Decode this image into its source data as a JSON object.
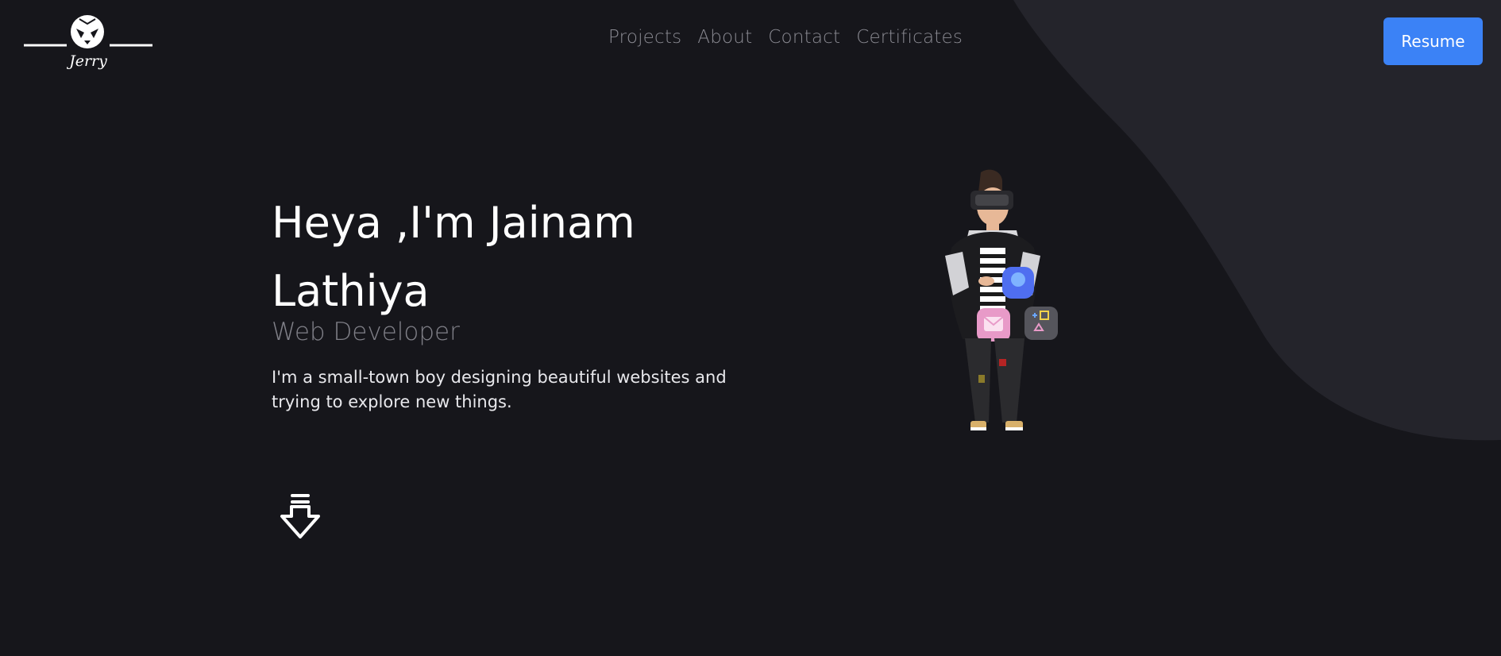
{
  "header": {
    "logo_text": "Jerry",
    "nav": [
      {
        "label": "Projects"
      },
      {
        "label": "About"
      },
      {
        "label": "Contact"
      },
      {
        "label": "Certificates"
      }
    ],
    "resume_label": "Resume"
  },
  "hero": {
    "title": "Heya ,I'm Jainam Lathiya",
    "subtitle": "Web Developer",
    "description": "I'm a small-town boy designing beautiful websites and trying to explore new things."
  },
  "icons": {
    "logo": "owl-mask-icon",
    "scroll": "arrow-down-icon",
    "illustration": "vr-character-illustration"
  },
  "colors": {
    "background": "#16161b",
    "wave": "#24242b",
    "accent": "#3b82f6",
    "nav_text": "#8a8a92",
    "subtitle_text": "#808088"
  }
}
